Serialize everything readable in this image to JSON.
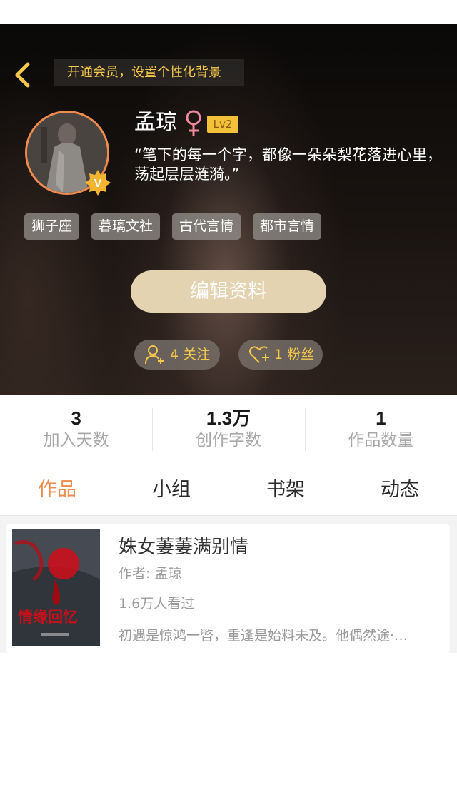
{
  "header": {
    "vip_banner": "开通会员，设置个性化背景",
    "nickname": "孟琼",
    "gender_symbol": "♀",
    "level": "Lv2",
    "verified_badge": "V",
    "bio": "“笔下的每一个字，都像一朵朵梨花落进心里，荡起层层涟漪。”",
    "tags": [
      "狮子座",
      "暮璃文社",
      "古代言情",
      "都市言情"
    ],
    "edit_button": "编辑资料",
    "following": "4 关注",
    "fans": "1 粉丝"
  },
  "stats": [
    {
      "value": "3",
      "label": "加入天数"
    },
    {
      "value": "1.3万",
      "label": "创作字数"
    },
    {
      "value": "1",
      "label": "作品数量"
    }
  ],
  "tabs": [
    "作品",
    "小组",
    "书架",
    "动态"
  ],
  "active_tab": "作品",
  "books": [
    {
      "title": "姝女萋萋满别情",
      "author": "作者: 孟琼",
      "views": "1.6万人看过",
      "description": "初遇是惊鸿一瞥，重逢是始料未及。他偶然途·…",
      "cover_text": "情缘回忆"
    }
  ],
  "colors": {
    "accent": "#f08a4d",
    "gold": "#f5c84b",
    "edit_button": "#e3d3b0",
    "level_badge": "#f3c03a"
  }
}
